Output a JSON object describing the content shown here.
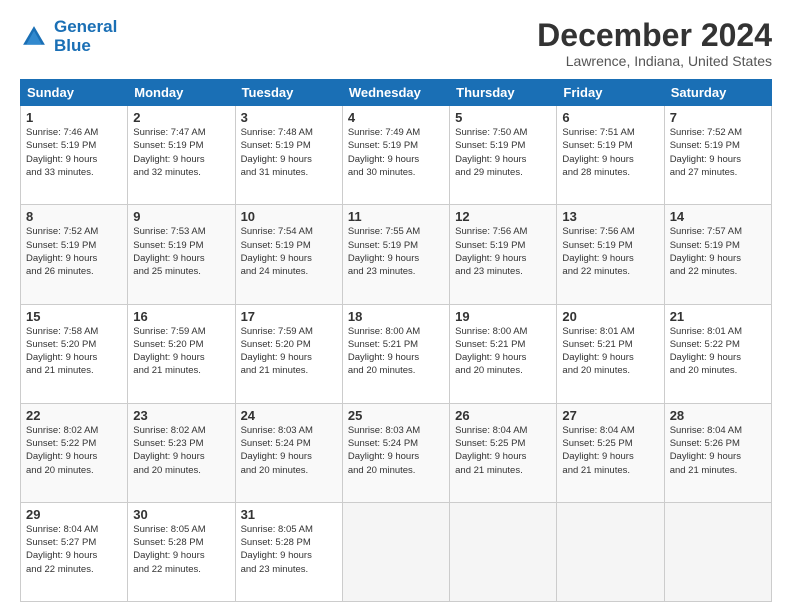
{
  "header": {
    "logo_line1": "General",
    "logo_line2": "Blue",
    "main_title": "December 2024",
    "subtitle": "Lawrence, Indiana, United States"
  },
  "calendar": {
    "days_of_week": [
      "Sunday",
      "Monday",
      "Tuesday",
      "Wednesday",
      "Thursday",
      "Friday",
      "Saturday"
    ],
    "weeks": [
      [
        {
          "num": "",
          "info": "",
          "empty": true
        },
        {
          "num": "",
          "info": "",
          "empty": true
        },
        {
          "num": "",
          "info": "",
          "empty": true
        },
        {
          "num": "",
          "info": "",
          "empty": true
        },
        {
          "num": "5",
          "info": "Sunrise: 7:50 AM\nSunset: 5:19 PM\nDaylight: 9 hours\nand 29 minutes.",
          "empty": false
        },
        {
          "num": "6",
          "info": "Sunrise: 7:51 AM\nSunset: 5:19 PM\nDaylight: 9 hours\nand 28 minutes.",
          "empty": false
        },
        {
          "num": "7",
          "info": "Sunrise: 7:52 AM\nSunset: 5:19 PM\nDaylight: 9 hours\nand 27 minutes.",
          "empty": false
        }
      ],
      [
        {
          "num": "1",
          "info": "Sunrise: 7:46 AM\nSunset: 5:19 PM\nDaylight: 9 hours\nand 33 minutes.",
          "empty": false
        },
        {
          "num": "2",
          "info": "Sunrise: 7:47 AM\nSunset: 5:19 PM\nDaylight: 9 hours\nand 32 minutes.",
          "empty": false
        },
        {
          "num": "3",
          "info": "Sunrise: 7:48 AM\nSunset: 5:19 PM\nDaylight: 9 hours\nand 31 minutes.",
          "empty": false
        },
        {
          "num": "4",
          "info": "Sunrise: 7:49 AM\nSunset: 5:19 PM\nDaylight: 9 hours\nand 30 minutes.",
          "empty": false
        },
        {
          "num": "",
          "info": "",
          "empty": true
        },
        {
          "num": "",
          "info": "",
          "empty": true
        },
        {
          "num": "",
          "info": "",
          "empty": true
        }
      ],
      [
        {
          "num": "8",
          "info": "Sunrise: 7:52 AM\nSunset: 5:19 PM\nDaylight: 9 hours\nand 26 minutes.",
          "empty": false
        },
        {
          "num": "9",
          "info": "Sunrise: 7:53 AM\nSunset: 5:19 PM\nDaylight: 9 hours\nand 25 minutes.",
          "empty": false
        },
        {
          "num": "10",
          "info": "Sunrise: 7:54 AM\nSunset: 5:19 PM\nDaylight: 9 hours\nand 24 minutes.",
          "empty": false
        },
        {
          "num": "11",
          "info": "Sunrise: 7:55 AM\nSunset: 5:19 PM\nDaylight: 9 hours\nand 23 minutes.",
          "empty": false
        },
        {
          "num": "12",
          "info": "Sunrise: 7:56 AM\nSunset: 5:19 PM\nDaylight: 9 hours\nand 23 minutes.",
          "empty": false
        },
        {
          "num": "13",
          "info": "Sunrise: 7:56 AM\nSunset: 5:19 PM\nDaylight: 9 hours\nand 22 minutes.",
          "empty": false
        },
        {
          "num": "14",
          "info": "Sunrise: 7:57 AM\nSunset: 5:19 PM\nDaylight: 9 hours\nand 22 minutes.",
          "empty": false
        }
      ],
      [
        {
          "num": "15",
          "info": "Sunrise: 7:58 AM\nSunset: 5:20 PM\nDaylight: 9 hours\nand 21 minutes.",
          "empty": false
        },
        {
          "num": "16",
          "info": "Sunrise: 7:59 AM\nSunset: 5:20 PM\nDaylight: 9 hours\nand 21 minutes.",
          "empty": false
        },
        {
          "num": "17",
          "info": "Sunrise: 7:59 AM\nSunset: 5:20 PM\nDaylight: 9 hours\nand 21 minutes.",
          "empty": false
        },
        {
          "num": "18",
          "info": "Sunrise: 8:00 AM\nSunset: 5:21 PM\nDaylight: 9 hours\nand 20 minutes.",
          "empty": false
        },
        {
          "num": "19",
          "info": "Sunrise: 8:00 AM\nSunset: 5:21 PM\nDaylight: 9 hours\nand 20 minutes.",
          "empty": false
        },
        {
          "num": "20",
          "info": "Sunrise: 8:01 AM\nSunset: 5:21 PM\nDaylight: 9 hours\nand 20 minutes.",
          "empty": false
        },
        {
          "num": "21",
          "info": "Sunrise: 8:01 AM\nSunset: 5:22 PM\nDaylight: 9 hours\nand 20 minutes.",
          "empty": false
        }
      ],
      [
        {
          "num": "22",
          "info": "Sunrise: 8:02 AM\nSunset: 5:22 PM\nDaylight: 9 hours\nand 20 minutes.",
          "empty": false
        },
        {
          "num": "23",
          "info": "Sunrise: 8:02 AM\nSunset: 5:23 PM\nDaylight: 9 hours\nand 20 minutes.",
          "empty": false
        },
        {
          "num": "24",
          "info": "Sunrise: 8:03 AM\nSunset: 5:24 PM\nDaylight: 9 hours\nand 20 minutes.",
          "empty": false
        },
        {
          "num": "25",
          "info": "Sunrise: 8:03 AM\nSunset: 5:24 PM\nDaylight: 9 hours\nand 20 minutes.",
          "empty": false
        },
        {
          "num": "26",
          "info": "Sunrise: 8:04 AM\nSunset: 5:25 PM\nDaylight: 9 hours\nand 21 minutes.",
          "empty": false
        },
        {
          "num": "27",
          "info": "Sunrise: 8:04 AM\nSunset: 5:25 PM\nDaylight: 9 hours\nand 21 minutes.",
          "empty": false
        },
        {
          "num": "28",
          "info": "Sunrise: 8:04 AM\nSunset: 5:26 PM\nDaylight: 9 hours\nand 21 minutes.",
          "empty": false
        }
      ],
      [
        {
          "num": "29",
          "info": "Sunrise: 8:04 AM\nSunset: 5:27 PM\nDaylight: 9 hours\nand 22 minutes.",
          "empty": false
        },
        {
          "num": "30",
          "info": "Sunrise: 8:05 AM\nSunset: 5:28 PM\nDaylight: 9 hours\nand 22 minutes.",
          "empty": false
        },
        {
          "num": "31",
          "info": "Sunrise: 8:05 AM\nSunset: 5:28 PM\nDaylight: 9 hours\nand 23 minutes.",
          "empty": false
        },
        {
          "num": "",
          "info": "",
          "empty": true
        },
        {
          "num": "",
          "info": "",
          "empty": true
        },
        {
          "num": "",
          "info": "",
          "empty": true
        },
        {
          "num": "",
          "info": "",
          "empty": true
        }
      ]
    ]
  }
}
